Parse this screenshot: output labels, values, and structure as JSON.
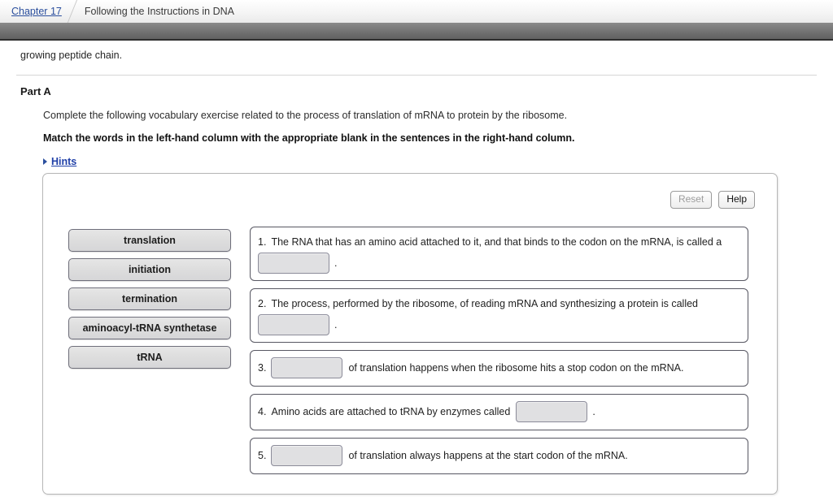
{
  "breadcrumb": {
    "link": "Chapter 17",
    "separator_icon": "chevron-right-icon",
    "current": "Following the Instructions in DNA"
  },
  "page": {
    "lead_text": "growing peptide chain.",
    "part_title": "Part A",
    "instruction_normal": "Complete the following vocabulary exercise related to the process of translation of mRNA to protein by the ribosome.",
    "instruction_bold": "Match the words in the left-hand column with the appropriate blank in the sentences in the right-hand column.",
    "hints_label": "Hints",
    "hints_icon": "triangle-right-icon"
  },
  "panel": {
    "reset_label": "Reset",
    "help_label": "Help",
    "word_bank": [
      {
        "label": "translation"
      },
      {
        "label": "initiation"
      },
      {
        "label": "termination"
      },
      {
        "label": "aminoacyl-tRNA synthetase"
      },
      {
        "label": "tRNA"
      }
    ],
    "sentences": [
      {
        "number": "1.",
        "layout": "blank-second-line",
        "text_before": "The RNA that has an amino acid attached to it, and that binds to the codon on the mRNA, is called a",
        "text_after": ".",
        "blank_value": ""
      },
      {
        "number": "2.",
        "layout": "blank-second-line",
        "text_before": "The process, performed by the ribosome, of reading mRNA and synthesizing a protein is called",
        "text_after": ".",
        "blank_value": ""
      },
      {
        "number": "3.",
        "layout": "blank-after-number",
        "text_before": "",
        "text_after": "of translation happens when the ribosome hits a stop codon on the mRNA.",
        "blank_value": ""
      },
      {
        "number": "4.",
        "layout": "blank-inline",
        "text_before": "Amino acids are attached to tRNA by enzymes called",
        "text_after": ".",
        "blank_value": ""
      },
      {
        "number": "5.",
        "layout": "blank-after-number",
        "text_before": "",
        "text_after": "of translation always happens at the start codon of the mRNA.",
        "blank_value": ""
      }
    ]
  },
  "colors": {
    "link": "#2b4f9e",
    "toolbar": "#7b7b7b",
    "tile_bg": "#dedede",
    "blank_bg": "#e0e0e2"
  }
}
